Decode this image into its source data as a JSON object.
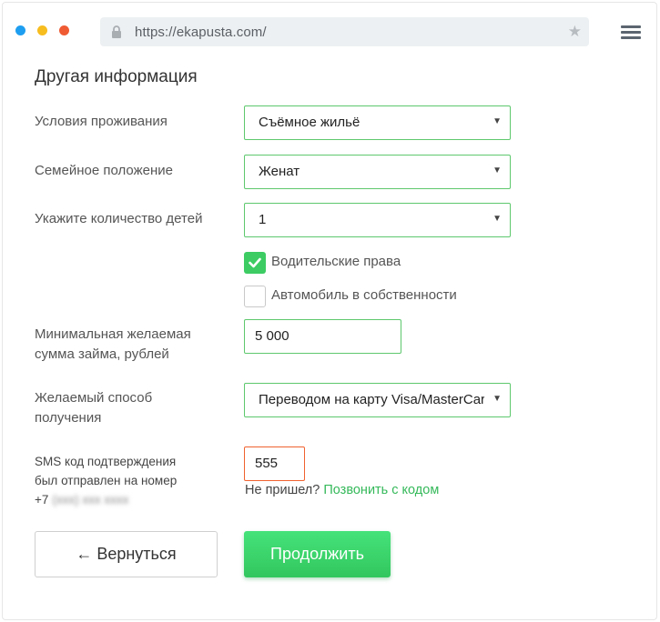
{
  "browser": {
    "url": "https://ekapusta.com/",
    "colors": {
      "dot_blue": "#1e9ef0",
      "dot_yellow": "#f7bd1f",
      "dot_red": "#ef5b33"
    }
  },
  "form": {
    "title": "Другая информация",
    "housing": {
      "label": "Условия проживания",
      "value": "Съёмное жильё"
    },
    "marital": {
      "label": "Семейное положение",
      "value": "Женат"
    },
    "children": {
      "label": "Укажите количество детей",
      "value": "1"
    },
    "license": {
      "label": "Водительские права",
      "checked": true
    },
    "car": {
      "label": "Автомобиль в собственности",
      "checked": false
    },
    "amount": {
      "label_line1": "Минимальная желаемая",
      "label_line2": "сумма займа, рублей",
      "value": "5 000"
    },
    "method": {
      "label_line1": "Желаемый способ",
      "label_line2": "получения",
      "value": "Переводом на карту Visa/MasterCard"
    },
    "sms": {
      "label_line1": "SMS код подтверждения",
      "label_line2": "был отправлен на номер",
      "phone_prefix": "+7",
      "phone_masked": "(xxx) xxx xxxx",
      "code": "555",
      "not_received": "Не пришел?",
      "call_link": "Позвонить с кодом"
    },
    "buttons": {
      "back": "← Вернуться",
      "next": "Продолжить"
    }
  },
  "colors": {
    "accent": "#3ccc63",
    "border_green": "#5dc86d",
    "error_border": "#f0622f",
    "link": "#35b95a"
  }
}
